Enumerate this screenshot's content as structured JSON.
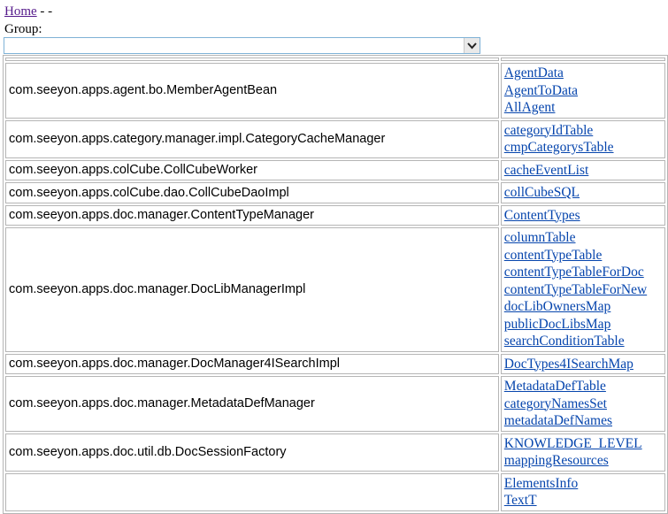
{
  "nav": {
    "home_label": "Home",
    "suffix": " - -"
  },
  "group": {
    "label": "Group:",
    "selected": ""
  },
  "rows": [
    {
      "class_name": "com.seeyon.apps.agent.bo.MemberAgentBean",
      "links": [
        "AgentData",
        "AgentToData",
        "AllAgent"
      ]
    },
    {
      "class_name": "com.seeyon.apps.category.manager.impl.CategoryCacheManager",
      "links": [
        "categoryIdTable",
        "cmpCategorysTable"
      ]
    },
    {
      "class_name": "com.seeyon.apps.colCube.CollCubeWorker",
      "links": [
        "cacheEventList"
      ]
    },
    {
      "class_name": "com.seeyon.apps.colCube.dao.CollCubeDaoImpl",
      "links": [
        "collCubeSQL"
      ]
    },
    {
      "class_name": "com.seeyon.apps.doc.manager.ContentTypeManager",
      "links": [
        "ContentTypes"
      ]
    },
    {
      "class_name": "com.seeyon.apps.doc.manager.DocLibManagerImpl",
      "links": [
        "columnTable",
        "contentTypeTable",
        "contentTypeTableForDoc",
        "contentTypeTableForNew",
        "docLibOwnersMap",
        "publicDocLibsMap",
        "searchConditionTable"
      ]
    },
    {
      "class_name": "com.seeyon.apps.doc.manager.DocManager4ISearchImpl",
      "links": [
        "DocTypes4ISearchMap"
      ]
    },
    {
      "class_name": "com.seeyon.apps.doc.manager.MetadataDefManager",
      "links": [
        "MetadataDefTable",
        "categoryNamesSet",
        "metadataDefNames"
      ]
    },
    {
      "class_name": "com.seeyon.apps.doc.util.db.DocSessionFactory",
      "links": [
        "KNOWLEDGE_LEVEL",
        "mappingResources"
      ]
    },
    {
      "class_name": "",
      "links": [
        "ElementsInfo",
        "TextT"
      ]
    }
  ]
}
